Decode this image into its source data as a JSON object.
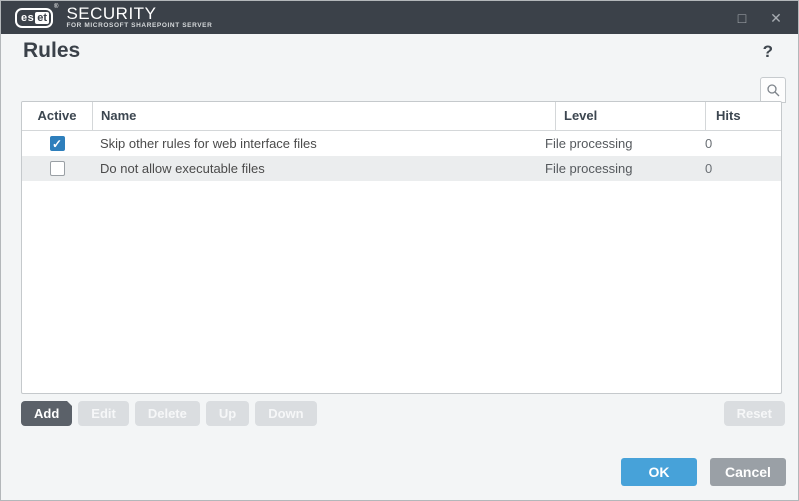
{
  "titlebar": {
    "brand_es": "es",
    "brand_et": "et",
    "brand_reg": "®",
    "product": "SECURITY",
    "subtitle": "FOR MICROSOFT SHAREPOINT SERVER",
    "maximize_glyph": "□",
    "close_glyph": "✕"
  },
  "page": {
    "title": "Rules",
    "help_glyph": "?"
  },
  "table": {
    "columns": [
      "Active",
      "Name",
      "Level",
      "Hits"
    ],
    "rows": [
      {
        "active": true,
        "name": "Skip other rules for web interface files",
        "level": "File processing",
        "hits": "0"
      },
      {
        "active": false,
        "name": "Do not allow executable files",
        "level": "File processing",
        "hits": "0"
      }
    ]
  },
  "actions": {
    "add": "Add",
    "edit": "Edit",
    "delete": "Delete",
    "up": "Up",
    "down": "Down",
    "reset": "Reset"
  },
  "footer": {
    "ok": "OK",
    "cancel": "Cancel"
  },
  "colors": {
    "titlebar_bg": "#3b4149",
    "content_bg": "#f3f5f6",
    "checkbox_checked": "#2e7fbc",
    "ok_button": "#47a2d9",
    "cancel_button": "#9aa0a6",
    "enabled_action_button": "#5b6169",
    "disabled_action_button": "#dadde0",
    "alt_row_bg": "#ebedee"
  }
}
